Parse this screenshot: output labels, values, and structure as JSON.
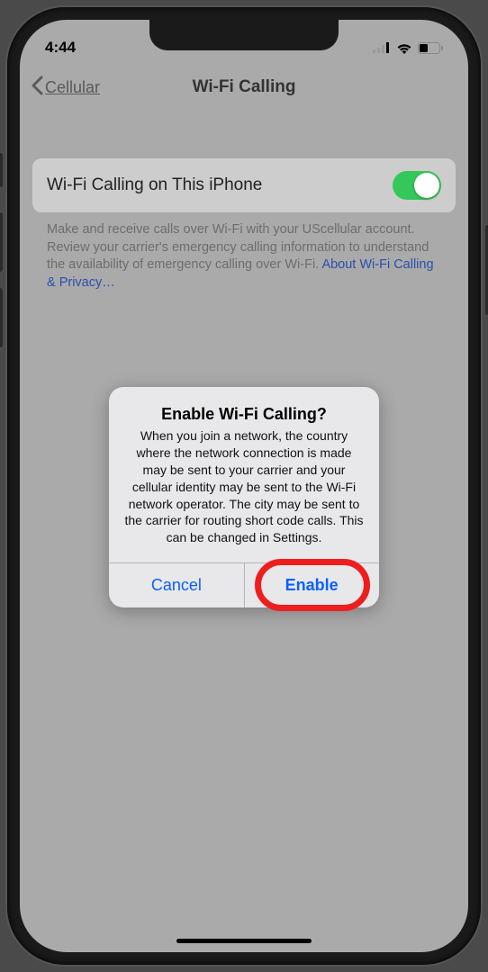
{
  "status": {
    "time": "4:44"
  },
  "nav": {
    "back": "Cellular",
    "title": "Wi-Fi Calling"
  },
  "setting": {
    "label": "Wi-Fi Calling on This iPhone",
    "desc": "Make and receive calls over Wi-Fi with your UScellular account. Review your carrier's emergency calling information to understand the availability of emergency calling over Wi-Fi. ",
    "link": "About Wi-Fi Calling & Privacy…",
    "toggle_on": true
  },
  "alert": {
    "title": "Enable Wi-Fi Calling?",
    "message": "When you join a network, the country where the network connection is made may be sent to your carrier and your cellular identity may be sent to the Wi-Fi network operator. The city may be sent to the carrier for routing short code calls. This can be changed in Settings.",
    "cancel": "Cancel",
    "confirm": "Enable"
  }
}
